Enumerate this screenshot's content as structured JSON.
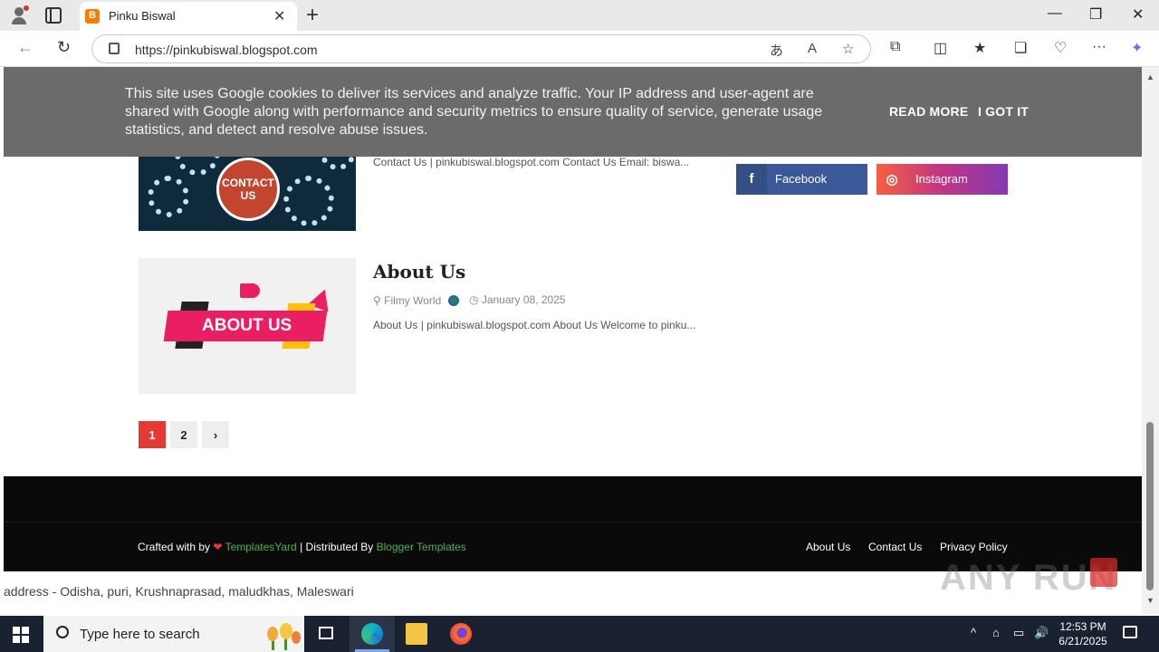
{
  "browser": {
    "tab_title": "Pinku Biswal",
    "url": "https://pinkubiswal.blogspot.com",
    "new_tab": "+",
    "tab_close": "✕",
    "win_min": "—",
    "win_restore": "❐",
    "win_close": "✕",
    "icons": {
      "back": "←",
      "refresh": "↻",
      "translate": "あ",
      "read_aloud": "A",
      "favorite": "☆",
      "extensions": "⧉",
      "split": "◫",
      "favorites": "★",
      "collections": "❏",
      "browser_essentials": "♡",
      "more": "···",
      "copilot": "✦"
    }
  },
  "cookie_banner": {
    "message": "This site uses Google cookies to deliver its services and analyze traffic. Your IP address and user-agent are shared with Google along with performance and security metrics to ensure quality of service, generate usage statistics, and detect and resolve abuse issues.",
    "read_more": "READ MORE",
    "got_it": "I GOT IT"
  },
  "posts": [
    {
      "thumb_text": "CONTACT US",
      "snippet": "Contact Us | pinkubiswal.blogspot.com Contact Us Email: biswa..."
    },
    {
      "title": "About Us",
      "thumb_text": "ABOUT US",
      "author": "Filmy World",
      "date": "January 08, 2025",
      "snippet": "About Us | pinkubiswal.blogspot.com About Us Welcome to pinku..."
    }
  ],
  "social": {
    "facebook_label": "Facebook",
    "facebook_icon": "f",
    "instagram_label": "Instagram",
    "instagram_icon": "◎"
  },
  "pagination": {
    "page1": "1",
    "page2": "2",
    "next": "›"
  },
  "footer": {
    "crafted": "Crafted with by",
    "heart": "❤",
    "templatesyard": "TemplatesYard",
    "distributed": "| Distributed By",
    "blogger_templates": "Blogger Templates",
    "links": [
      "About Us",
      "Contact Us",
      "Privacy Policy"
    ]
  },
  "address_text": "address - Odisha, puri, Krushnaprasad, maludkhas, Maleswari",
  "watermark": "ANY RUN",
  "taskbar": {
    "search_placeholder": "Type here to search",
    "time": "12:53 PM",
    "date": "6/21/2025",
    "tray_icons": [
      "^",
      "⌂",
      "▭",
      "🔊"
    ]
  },
  "colors": {
    "cookie_bg": "#6b6b6b",
    "facebook": "#3b5998",
    "page_active": "#e53935",
    "footer_bg": "#0a0a0a",
    "accent_green": "#4caf50"
  }
}
